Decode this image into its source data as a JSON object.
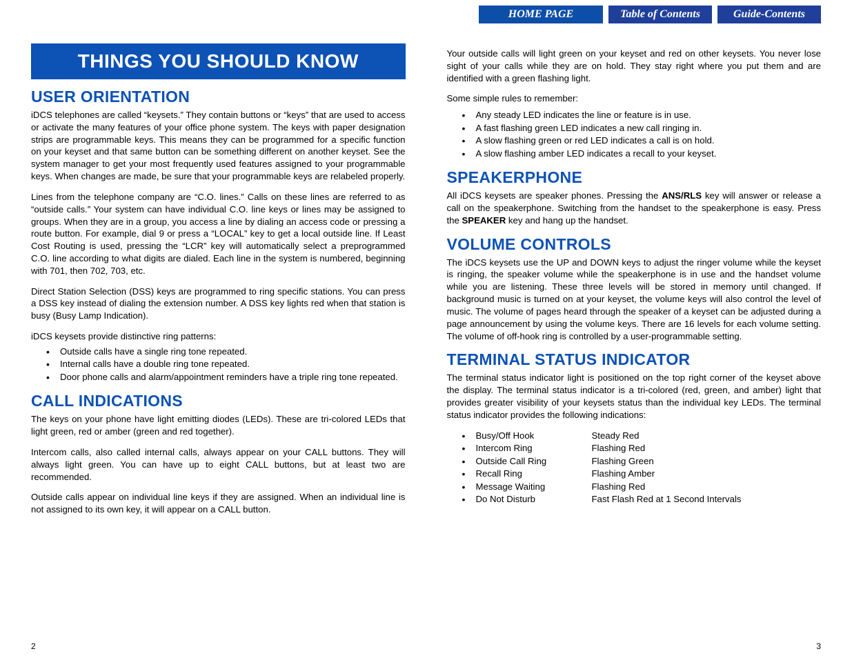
{
  "nav": {
    "home": "HOME PAGE",
    "toc": "Table of Contents",
    "guide": "Guide-Contents"
  },
  "left": {
    "banner": "THINGS YOU SHOULD KNOW",
    "h_user_orientation": "USER ORIENTATION",
    "uo_p1": "iDCS telephones are called “keysets.” They contain buttons or “keys” that are used to access or activate the many features of your office phone system. The keys with paper designation strips are programmable keys. This means they can be programmed for a specific function on your keyset and that same button can be something different on another keyset. See the system manager to get your most frequently used features assigned to your programmable keys. When changes are made, be sure that your programmable keys are relabeled properly.",
    "uo_p2": "Lines from the telephone company are “C.O. lines.” Calls on these lines are referred to as “outside calls.” Your system can have individual C.O. line keys or lines may be assigned to groups. When they are in a group, you access a line by dialing an access code or pressing a route button. For example, dial 9 or press a “LOCAL” key to get a local outside line. If Least Cost Routing is used, pressing the “LCR” key will automatically select a preprogrammed C.O. line according to what digits are dialed. Each line in the system is numbered, beginning with 701, then 702, 703, etc.",
    "uo_p3": "Direct Station Selection (DSS) keys are programmed to ring specific stations. You can press a DSS key instead of dialing the extension number. A DSS key  lights red when that station is busy (Busy Lamp Indication).",
    "uo_p4": "iDCS keysets provide distinctive ring patterns:",
    "uo_list": [
      "Outside calls have a single ring tone repeated.",
      "Internal calls have a double ring tone repeated.",
      "Door phone calls and alarm/appointment reminders have a triple ring tone repeated."
    ],
    "h_call_indications": "CALL INDICATIONS",
    "ci_p1": "The keys on your phone have light emitting diodes (LEDs). These are tri-colored LEDs that light green, red or amber (green and red together).",
    "ci_p2": "Intercom calls, also called internal calls, always appear on your CALL buttons. They will always light green. You can have up to eight CALL buttons, but at least two are recommended.",
    "ci_p3": "Outside calls appear on individual line keys if they are assigned. When an individual line is not assigned to its own key, it will appear on a CALL button.",
    "page_num": "2"
  },
  "right": {
    "ci_p4": "Your outside calls will light green on your keyset and red on other keysets. You never lose sight of your calls while they are on hold. They stay right where you put them and are identified with a green flashing light.",
    "ci_p5": "Some simple rules to remember:",
    "ci_list": [
      "Any steady LED indicates the line or feature is in use.",
      "A fast flashing green LED indicates a new call ringing in.",
      "A slow flashing green or red LED indicates a call is on hold.",
      "A slow flashing amber LED indicates a recall to your keyset."
    ],
    "h_speakerphone": "SPEAKERPHONE",
    "sp_p1_a": "All iDCS keysets are speaker phones. Pressing the ",
    "sp_p1_b": "ANS/RLS",
    "sp_p1_c": " key will answer or release a call on the speakerphone. Switching from the handset to the speakerphone is easy. Press the ",
    "sp_p1_d": "SPEAKER",
    "sp_p1_e": " key and hang up the handset.",
    "h_volume": "VOLUME CONTROLS",
    "vc_p1": "The iDCS keysets use the UP and DOWN keys to adjust the ringer volume while the keyset is ringing, the speaker volume while the speakerphone is in use and the handset volume while you are listening. These three levels will be stored in memory until changed. If background music is turned on at your keyset, the volume keys will also control the level of music. The volume of pages heard through the speaker of a keyset can be adjusted during a page announcement by using the volume keys. There are 16 levels for each volume setting. The volume of off-hook ring is controlled by a user-programmable setting.",
    "h_tsi": "TERMINAL STATUS INDICATOR",
    "tsi_p1": "The terminal status indicator light is positioned on the top right corner of the keyset above the display. The terminal status indicator is a tri-colored (red, green, and amber) light that provides greater visibility of your keysets status than the individual key LEDs. The terminal status indicator provides the following indications:",
    "tsi_list": [
      {
        "l": "Busy/Off Hook",
        "v": "Steady Red"
      },
      {
        "l": "Intercom Ring",
        "v": "Flashing Red"
      },
      {
        "l": "Outside Call Ring",
        "v": "Flashing Green"
      },
      {
        "l": "Recall Ring",
        "v": "Flashing Amber"
      },
      {
        "l": "Message Waiting",
        "v": "Flashing Red"
      },
      {
        "l": "Do Not Disturb",
        "v": "Fast Flash Red at 1 Second Intervals"
      }
    ],
    "page_num": "3"
  }
}
